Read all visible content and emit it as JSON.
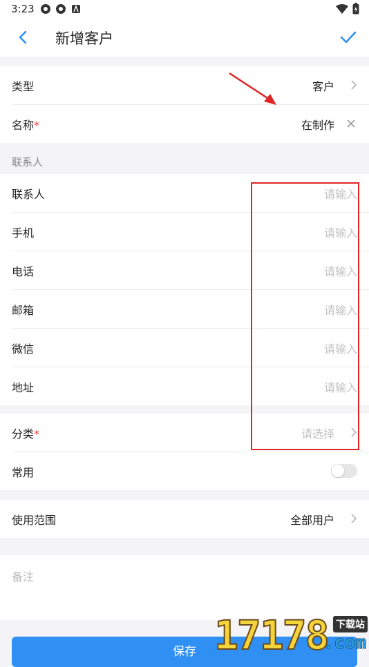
{
  "status_bar": {
    "time": "3:23"
  },
  "header": {
    "title": "新增客户"
  },
  "basic": {
    "type_label": "类型",
    "type_value": "客户",
    "name_label": "名称",
    "name_required": "*",
    "name_value": "在制作"
  },
  "contact_group_title": "联系人",
  "contact_fields": [
    {
      "label": "联系人",
      "placeholder": "请输入"
    },
    {
      "label": "手机",
      "placeholder": "请输入"
    },
    {
      "label": "电话",
      "placeholder": "请输入"
    },
    {
      "label": "邮箱",
      "placeholder": "请输入"
    },
    {
      "label": "微信",
      "placeholder": "请输入"
    },
    {
      "label": "地址",
      "placeholder": "请输入"
    }
  ],
  "category": {
    "label": "分类",
    "required": "*",
    "placeholder": "请选择"
  },
  "common": {
    "label": "常用",
    "enabled": false
  },
  "scope": {
    "label": "使用范围",
    "value": "全部用户"
  },
  "notes": {
    "placeholder": "备注"
  },
  "save_button": {
    "label": "保存"
  },
  "watermark": {
    "number": "17178",
    "badge": "下载站",
    "suffix": ".com"
  },
  "colors": {
    "accent": "#2f8ff3",
    "required": "#e8413a",
    "annotation": "#e02424"
  }
}
